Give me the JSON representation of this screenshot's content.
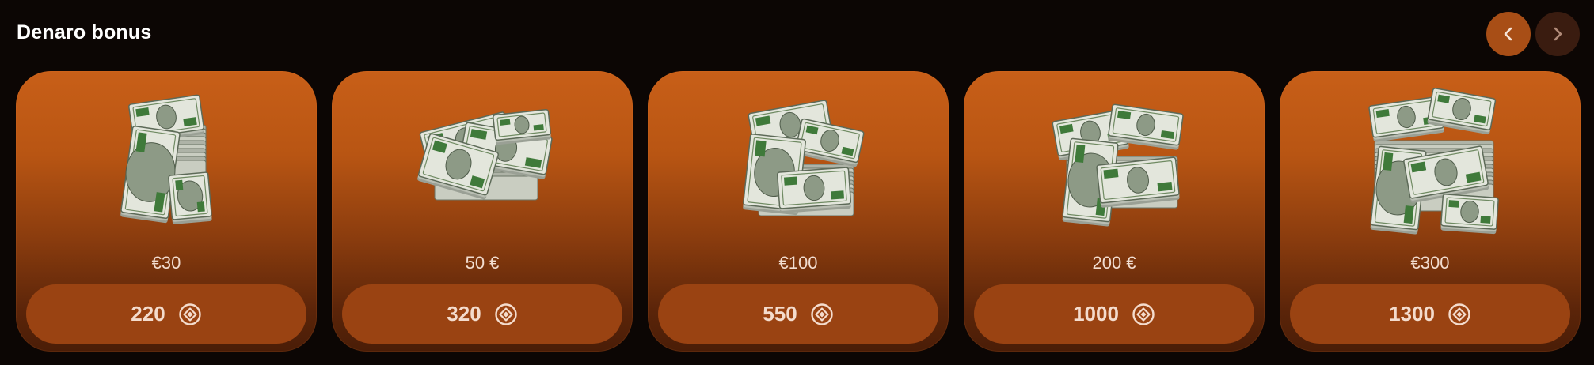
{
  "header": {
    "title": "Denaro bonus",
    "prev_icon": "chevron-left-icon",
    "next_icon": "chevron-right-icon"
  },
  "cards": [
    {
      "price": "€30",
      "cost": "220",
      "image": "cash-stack-icon",
      "coin_icon": "diamond-coin-icon"
    },
    {
      "price": "50 €",
      "cost": "320",
      "image": "cash-stack-icon",
      "coin_icon": "diamond-coin-icon"
    },
    {
      "price": "€100",
      "cost": "550",
      "image": "cash-stack-icon",
      "coin_icon": "diamond-coin-icon"
    },
    {
      "price": "200 €",
      "cost": "1000",
      "image": "cash-stack-icon",
      "coin_icon": "diamond-coin-icon"
    },
    {
      "price": "€300",
      "cost": "1300",
      "image": "cash-stack-icon",
      "coin_icon": "diamond-coin-icon"
    }
  ],
  "colors": {
    "background": "#0c0604",
    "card_top": "#c85f18",
    "card_bottom": "#4a1d07",
    "button": "#9a4312",
    "nav_active": "#a84e16",
    "nav_inactive": "#3a1c10"
  }
}
